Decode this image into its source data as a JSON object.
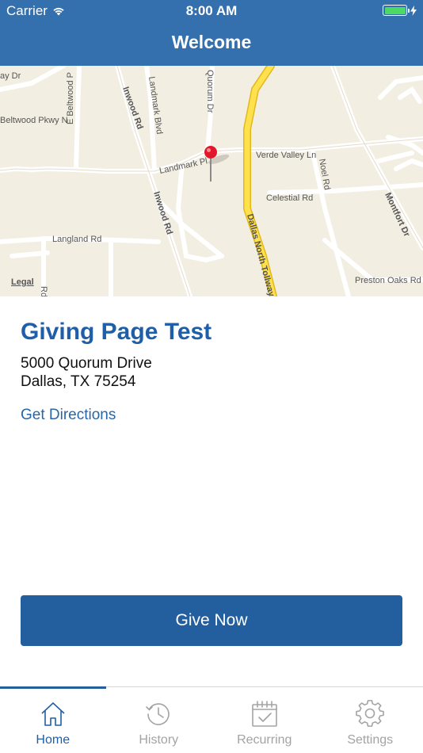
{
  "status_bar": {
    "carrier": "Carrier",
    "time": "8:00 AM"
  },
  "header": {
    "title": "Welcome"
  },
  "map": {
    "legal": "Legal",
    "streets": [
      "ay Dr",
      "E Beltwood P",
      "Beltwood Pkwy N",
      "Inwood Rd",
      "Landmark Blvd",
      "Quorum Dr",
      "Landmark Pl",
      "Verde Valley Ln",
      "Noel Rd",
      "Celestial Rd",
      "Montfort Dr",
      "Inwood Rd",
      "Langland Rd",
      "Dallas North Tollway",
      "Preston Oaks Rd",
      "Rd"
    ]
  },
  "location": {
    "name": "Giving Page Test",
    "address_line1": "5000 Quorum Drive",
    "address_line2": "Dallas, TX 75254",
    "directions_label": "Get Directions"
  },
  "give_button": {
    "label": "Give Now"
  },
  "tabs": [
    {
      "label": "Home",
      "icon": "home-icon",
      "active": true
    },
    {
      "label": "History",
      "icon": "history-icon",
      "active": false
    },
    {
      "label": "Recurring",
      "icon": "calendar-check-icon",
      "active": false
    },
    {
      "label": "Settings",
      "icon": "gear-icon",
      "active": false
    }
  ],
  "colors": {
    "brand": "#3470ae",
    "button": "#235f9f",
    "title_text": "#1f5ea8",
    "inactive": "#a3a3a3"
  }
}
